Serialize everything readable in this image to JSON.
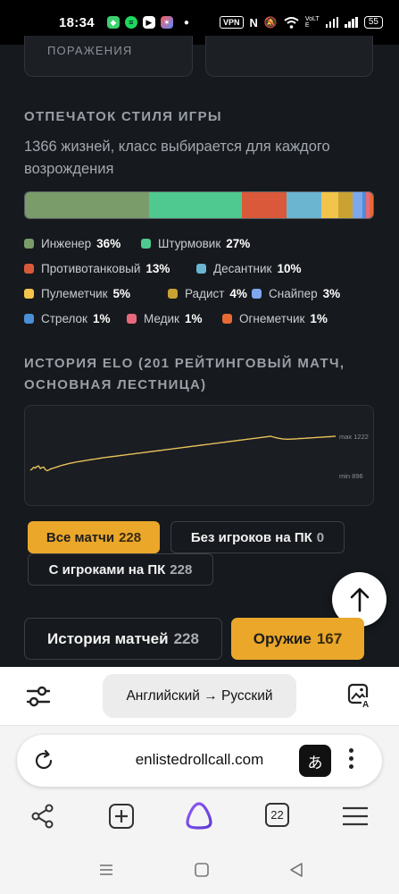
{
  "status_bar": {
    "time": "18:34",
    "vpn": "VPN",
    "lte": "VoLTE",
    "battery": "55",
    "icons": [
      "shield-app-icon",
      "spotify-icon",
      "youtube-icon",
      "photos-app-icon",
      "nfc-icon",
      "mute-icon",
      "wifi-icon",
      "signal-icon"
    ]
  },
  "top_cards": {
    "left_label": "ПОРАЖЕНИЯ"
  },
  "style_fingerprint": {
    "title": "ОТПЕЧАТОК СТИЛЯ ИГРЫ",
    "subtitle": "1366 жизней, класс выбирается для каждого возрождения",
    "classes": [
      {
        "name": "Инженер",
        "pct": "36%",
        "value": 36,
        "color": "#7a9b6a"
      },
      {
        "name": "Штурмовик",
        "pct": "27%",
        "value": 27,
        "color": "#4fc98f"
      },
      {
        "name": "Противотанковый",
        "pct": "13%",
        "value": 13,
        "color": "#d9593a"
      },
      {
        "name": "Десантник",
        "pct": "10%",
        "value": 10,
        "color": "#6bb5d1"
      },
      {
        "name": "Пулеметчик",
        "pct": "5%",
        "value": 5,
        "color": "#f2c44b"
      },
      {
        "name": "Радист",
        "pct": "4%",
        "value": 4,
        "color": "#c9a232"
      },
      {
        "name": "Снайпер",
        "pct": "3%",
        "value": 3,
        "color": "#7fa7ee"
      },
      {
        "name": "Стрелок",
        "pct": "1%",
        "value": 1,
        "color": "#4a8fd6"
      },
      {
        "name": "Медик",
        "pct": "1%",
        "value": 1,
        "color": "#e8697b"
      },
      {
        "name": "Огнеметчик",
        "pct": "1%",
        "value": 1,
        "color": "#e76a35"
      }
    ]
  },
  "elo": {
    "title": "ИСТОРИЯ ELO (201 РЕЙТИНГОВЫЙ МАТЧ, ОСНОВНАЯ ЛЕСТНИЦА)",
    "max_label": "max 1222",
    "min_label": "min 896",
    "line_color": "#e8c25a",
    "points": [
      905,
      915,
      932,
      925,
      940,
      944,
      920,
      930,
      934,
      910,
      900,
      906,
      915,
      920,
      925,
      930,
      935,
      940,
      946,
      950,
      955,
      958,
      962,
      966,
      970,
      973,
      976,
      980,
      983,
      985,
      988,
      990,
      993,
      995,
      998,
      1000,
      1003,
      1005,
      1008,
      1010,
      1012,
      1015,
      1017,
      1020,
      1022,
      1024,
      1026,
      1028,
      1030,
      1032,
      1034,
      1036,
      1038,
      1040,
      1042,
      1044,
      1046,
      1048,
      1050,
      1052,
      1054,
      1056,
      1058,
      1060,
      1062,
      1064,
      1066,
      1068,
      1070,
      1072,
      1074,
      1076,
      1078,
      1080,
      1082,
      1084,
      1086,
      1088,
      1090,
      1092,
      1094,
      1096,
      1098,
      1100,
      1102,
      1104,
      1106,
      1108,
      1110,
      1112,
      1114,
      1116,
      1118,
      1120,
      1122,
      1124,
      1126,
      1128,
      1130,
      1132,
      1134,
      1136,
      1138,
      1140,
      1142,
      1144,
      1146,
      1148,
      1150,
      1152,
      1154,
      1156,
      1158,
      1160,
      1162,
      1164,
      1166,
      1168,
      1170,
      1172,
      1174,
      1176,
      1178,
      1180,
      1182,
      1184,
      1186,
      1188,
      1190,
      1192,
      1194,
      1196,
      1198,
      1200,
      1202,
      1204,
      1206,
      1208,
      1210,
      1212,
      1214,
      1216,
      1218,
      1220,
      1222,
      1218,
      1214,
      1210,
      1206,
      1203,
      1200,
      1198,
      1196,
      1195,
      1194,
      1194,
      1195,
      1196,
      1197,
      1198,
      1199,
      1200,
      1201,
      1202,
      1203,
      1204,
      1205,
      1206,
      1207,
      1208,
      1209,
      1210,
      1211,
      1212,
      1213,
      1214,
      1215,
      1216,
      1217,
      1218,
      1219,
      1220,
      1221,
      1222
    ],
    "ymin": 896,
    "ymax": 1222
  },
  "filters": {
    "all": {
      "label": "Все матчи",
      "count": "228"
    },
    "no_pc": {
      "label": "Без игроков на ПК",
      "count": "0"
    },
    "with_pc": {
      "label": "С игроками на ПК",
      "count": "228"
    }
  },
  "tabs": {
    "history": {
      "label": "История матчей",
      "count": "228"
    },
    "weapons": {
      "label": "Оружие",
      "count": "167"
    }
  },
  "translator": {
    "direction": "Английский → Русский"
  },
  "browser": {
    "url": "enlistedrollcall.com",
    "translate_glyph": "あ",
    "tabs_count": "22"
  }
}
